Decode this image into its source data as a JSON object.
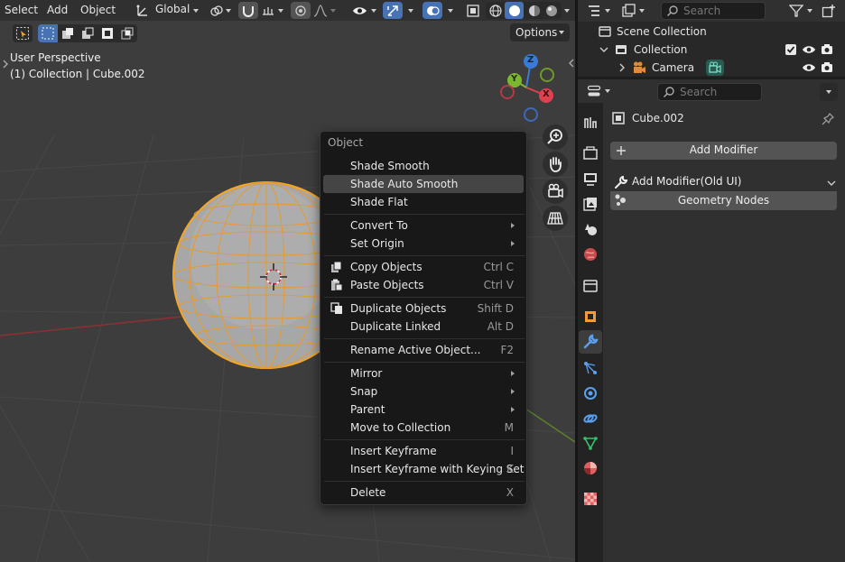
{
  "header": {
    "menu": [
      "Select",
      "Add",
      "Object"
    ],
    "orientation_label": "Global",
    "options_label": "Options"
  },
  "viewport": {
    "info_line1": "User Perspective",
    "info_line2": "(1) Collection | Cube.002",
    "gizmo": {
      "z": "Z",
      "y": "Y",
      "x": "X"
    }
  },
  "context_menu": {
    "title": "Object",
    "items": [
      {
        "label": "Shade Smooth",
        "shortcut": "",
        "submenu": false,
        "icon": ""
      },
      {
        "label": "Shade Auto Smooth",
        "shortcut": "",
        "submenu": false,
        "icon": "",
        "highlight": true
      },
      {
        "label": "Shade Flat",
        "shortcut": "",
        "submenu": false,
        "icon": ""
      },
      {
        "label": "Convert To",
        "shortcut": "",
        "submenu": true,
        "icon": ""
      },
      {
        "label": "Set Origin",
        "shortcut": "",
        "submenu": true,
        "icon": ""
      },
      {
        "label": "Copy Objects",
        "shortcut": "Ctrl C",
        "submenu": false,
        "icon": "copy-icon"
      },
      {
        "label": "Paste Objects",
        "shortcut": "Ctrl V",
        "submenu": false,
        "icon": "paste-icon"
      },
      {
        "label": "Duplicate Objects",
        "shortcut": "Shift D",
        "submenu": false,
        "icon": "duplicate-icon"
      },
      {
        "label": "Duplicate Linked",
        "shortcut": "Alt D",
        "submenu": false,
        "icon": ""
      },
      {
        "label": "Rename Active Object...",
        "shortcut": "F2",
        "submenu": false,
        "icon": ""
      },
      {
        "label": "Mirror",
        "shortcut": "",
        "submenu": true,
        "icon": ""
      },
      {
        "label": "Snap",
        "shortcut": "",
        "submenu": true,
        "icon": ""
      },
      {
        "label": "Parent",
        "shortcut": "",
        "submenu": true,
        "icon": ""
      },
      {
        "label": "Move to Collection",
        "shortcut": "M",
        "submenu": false,
        "icon": ""
      },
      {
        "label": "Insert Keyframe",
        "shortcut": "I",
        "submenu": false,
        "icon": ""
      },
      {
        "label": "Insert Keyframe with Keying Set",
        "shortcut": "K",
        "submenu": false,
        "icon": ""
      },
      {
        "label": "Delete",
        "shortcut": "X",
        "submenu": false,
        "icon": ""
      }
    ]
  },
  "outliner": {
    "search_placeholder": "Search",
    "rows": [
      {
        "label": "Scene Collection",
        "icon": "scene-collection-icon"
      },
      {
        "label": "Collection",
        "icon": "collection-icon"
      },
      {
        "label": "Camera",
        "icon": "camera-object-icon"
      }
    ]
  },
  "properties": {
    "search_placeholder": "Search",
    "object_name": "Cube.002",
    "add_modifier_label": "Add Modifier",
    "add_modifier_old_label": "Add Modifier(Old UI)",
    "geometry_nodes_label": "Geometry Nodes"
  },
  "colors": {
    "accent_blue": "#4772b3",
    "selection_orange": "#f5a623",
    "axis_x": "#e0414f",
    "axis_y": "#7cb82f",
    "axis_z": "#3a7bd5"
  }
}
